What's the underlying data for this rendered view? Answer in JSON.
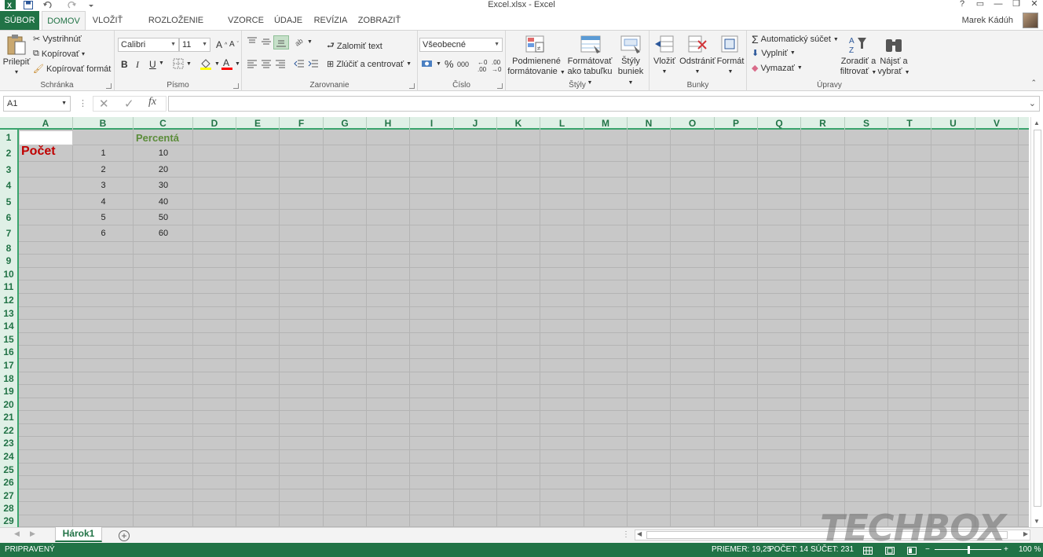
{
  "window": {
    "title": "Excel.xlsx - Excel",
    "controls": [
      "?",
      "▭",
      "—",
      "❐",
      "✕"
    ]
  },
  "tabs": [
    {
      "label": "SÚBOR"
    },
    {
      "label": "DOMOV"
    },
    {
      "label": "VLOŽIŤ"
    },
    {
      "label": "ROZLOŽENIE STRANY"
    },
    {
      "label": "VZORCE"
    },
    {
      "label": "ÚDAJE"
    },
    {
      "label": "REVÍZIA"
    },
    {
      "label": "ZOBRAZIŤ"
    }
  ],
  "user": {
    "name": "Marek Kádúh"
  },
  "ribbon": {
    "clipboard": {
      "label": "Schránka",
      "paste": "Prilepiť",
      "cut": "Vystrihnúť",
      "copy": "Kopírovať",
      "format_painter": "Kopírovať formát"
    },
    "font": {
      "label": "Písmo",
      "font_name": "Calibri",
      "font_size": "11",
      "bold": "B",
      "italic": "I",
      "underline": "U"
    },
    "alignment": {
      "label": "Zarovnanie",
      "wrap_text": "Zalomiť text",
      "merge_center": "Zlúčiť a centrovať"
    },
    "number": {
      "label": "Číslo",
      "format": "Všeobecné",
      "percent": "%",
      "thousands": "000"
    },
    "styles": {
      "label": "Štýly",
      "conditional_1": "Podmienené",
      "conditional_2": "formátovanie",
      "format_table_1": "Formátovať",
      "format_table_2": "ako tabuľku",
      "cell_styles_1": "Štýly",
      "cell_styles_2": "buniek"
    },
    "cells": {
      "label": "Bunky",
      "insert": "Vložiť",
      "delete": "Odstrániť",
      "format": "Formát"
    },
    "editing": {
      "label": "Úpravy",
      "autosum": "Automatický súčet",
      "fill": "Vyplniť",
      "clear": "Vymazať",
      "sort_1": "Zoradiť a",
      "sort_2": "filtrovať",
      "find_1": "Nájsť a",
      "find_2": "vybrať"
    }
  },
  "formula_bar": {
    "name_box": "A1",
    "fx": "fx",
    "value": ""
  },
  "columns": [
    "A",
    "B",
    "C",
    "D",
    "E",
    "F",
    "G",
    "H",
    "I",
    "J",
    "K",
    "L",
    "M",
    "N",
    "O",
    "P",
    "Q",
    "R",
    "S",
    "T",
    "U",
    "V"
  ],
  "rows": [
    "1",
    "2",
    "3",
    "4",
    "5",
    "6",
    "7",
    "8",
    "9",
    "10",
    "11",
    "12",
    "13",
    "14",
    "15",
    "16",
    "17",
    "18",
    "19",
    "20",
    "21",
    "22",
    "23",
    "24",
    "25",
    "26",
    "27",
    "28",
    "29"
  ],
  "cells": {
    "C1": "Percentá",
    "A2": "Počet",
    "B2": "1",
    "C2": "10",
    "B3": "2",
    "C3": "20",
    "B4": "3",
    "C4": "30",
    "B5": "4",
    "C5": "40",
    "B6": "5",
    "C6": "50",
    "B7": "6",
    "C7": "60"
  },
  "colors": {
    "accent": "#217346",
    "header_text_C1": "#5b8c3a",
    "header_text_A2": "#c00000",
    "grid_fill": "#c8c8c8"
  },
  "sheets": [
    {
      "name": "Hárok1"
    }
  ],
  "watermark": "TECHBOX",
  "status": {
    "ready": "PRIPRAVENÝ",
    "average": "PRIEMER: 19,25",
    "count": "POČET: 14",
    "sum": "SÚČET: 231",
    "zoom": "100 %",
    "zoom_fraction": 0.5
  }
}
